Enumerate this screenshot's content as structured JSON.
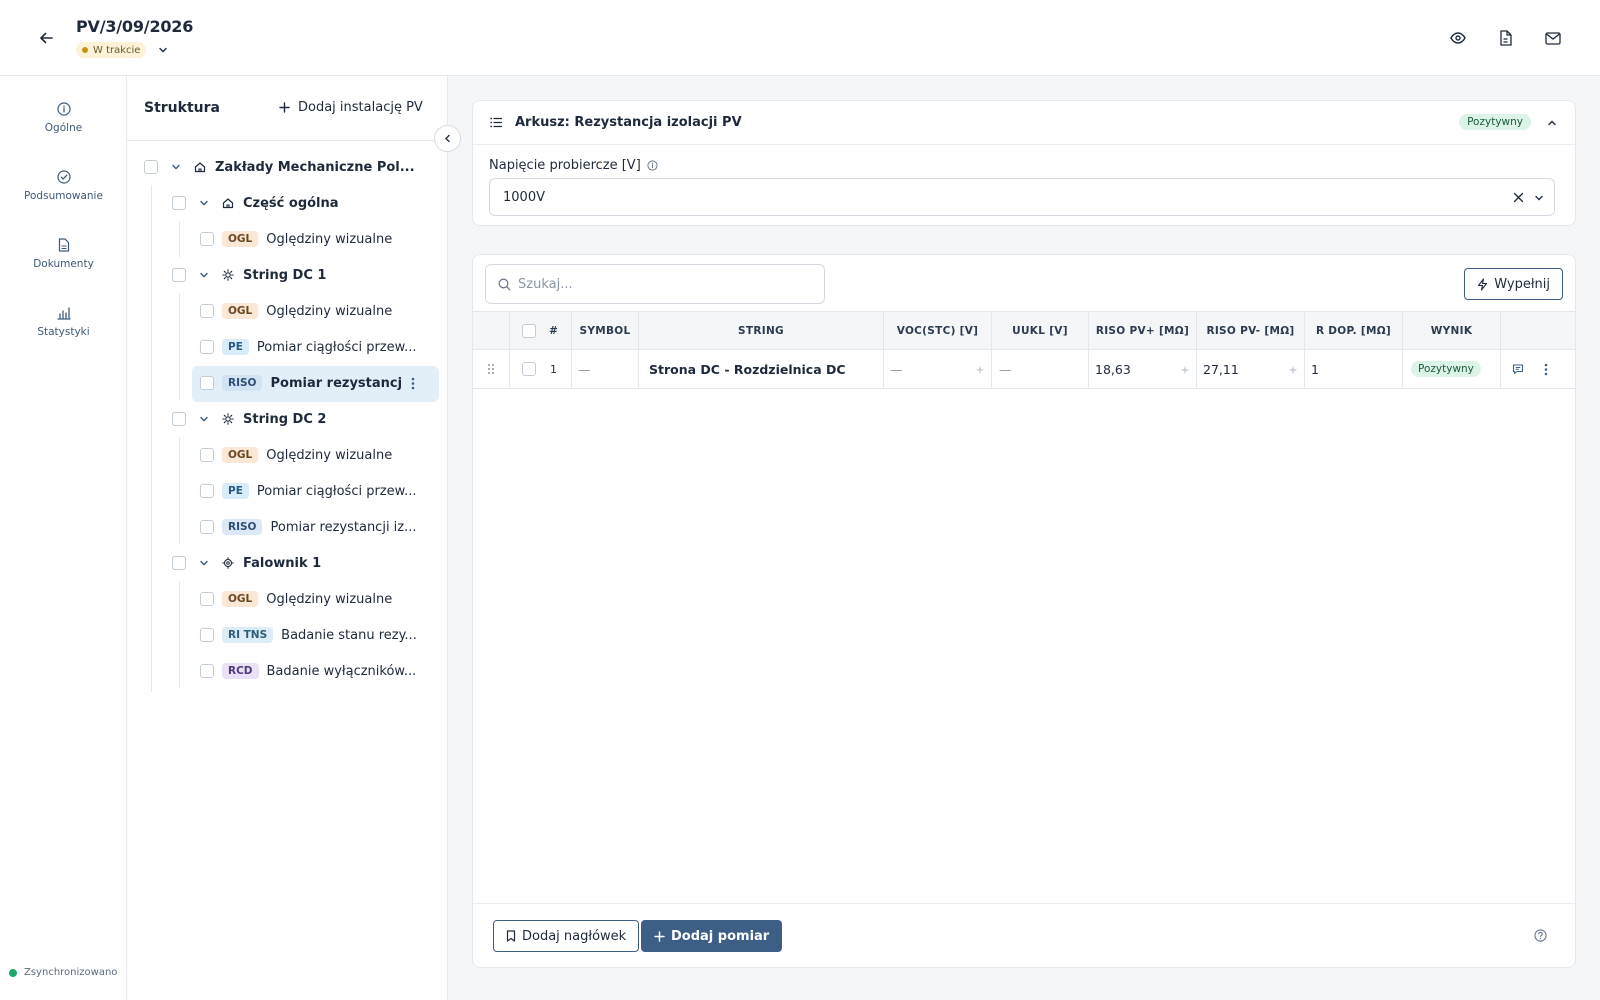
{
  "header": {
    "title": "PV/3/09/2026",
    "status": "W trakcie"
  },
  "nav": {
    "items": [
      {
        "label": "Ogólne",
        "icon": "info-icon"
      },
      {
        "label": "Podsumowanie",
        "icon": "check-circle-icon"
      },
      {
        "label": "Dokumenty",
        "icon": "document-icon"
      },
      {
        "label": "Statystyki",
        "icon": "bar-chart-icon"
      }
    ],
    "sync_status": "Zsynchronizowano"
  },
  "structure": {
    "title": "Struktura",
    "add_label": "Dodaj instalację PV",
    "root": "Zakłady Mechaniczne Pol...",
    "groups": [
      {
        "name": "Część ogólna",
        "icon": "home-icon",
        "items": [
          {
            "badge": "OGL",
            "label": "Oględziny wizualne"
          }
        ]
      },
      {
        "name": "String DC 1",
        "icon": "sun-icon",
        "items": [
          {
            "badge": "OGL",
            "label": "Oględziny wizualne"
          },
          {
            "badge": "PE",
            "label": "Pomiar ciągłości przew..."
          },
          {
            "badge": "RISO",
            "label": "Pomiar rezystancji i...",
            "selected": true
          }
        ]
      },
      {
        "name": "String DC 2",
        "icon": "sun-icon",
        "items": [
          {
            "badge": "OGL",
            "label": "Oględziny wizualne"
          },
          {
            "badge": "PE",
            "label": "Pomiar ciągłości przew..."
          },
          {
            "badge": "RISO",
            "label": "Pomiar rezystancji iz..."
          }
        ]
      },
      {
        "name": "Falownik 1",
        "icon": "cpu-icon",
        "items": [
          {
            "badge": "OGL",
            "label": "Oględziny wizualne"
          },
          {
            "badge": "RI TNS",
            "label": "Badanie stanu rezy..."
          },
          {
            "badge": "RCD",
            "label": "Badanie wyłączników..."
          }
        ]
      }
    ]
  },
  "sheet": {
    "title": "Arkusz: Rezystancja izolacji PV",
    "result": "Pozytywny",
    "voltage_label": "Napięcie probiercze [V]",
    "voltage_value": "1000V"
  },
  "table": {
    "search_placeholder": "Szukaj...",
    "fill_label": "Wypełnij",
    "columns": [
      "#",
      "SYMBOL",
      "STRING",
      "VOC(STC) [V]",
      "UUKL [V]",
      "RISO PV+ [MΩ]",
      "RISO PV- [MΩ]",
      "R DOP. [MΩ]",
      "WYNIK"
    ],
    "rows": [
      {
        "num": "1",
        "symbol": "—",
        "string": "Strona DC - Rozdzielnica DC",
        "voc": "—",
        "uukl": "—",
        "riso_plus": "18,63",
        "riso_minus": "27,11",
        "r_dop": "1",
        "result": "Pozytywny"
      }
    ],
    "add_header_label": "Dodaj nagłówek",
    "add_measurement_label": "Dodaj pomiar"
  },
  "colors": {
    "primary": "#3e5f85",
    "positive_bg": "#dcf3e7",
    "status_bg": "#fdf1d8",
    "selected_bg": "#e2eef8"
  }
}
